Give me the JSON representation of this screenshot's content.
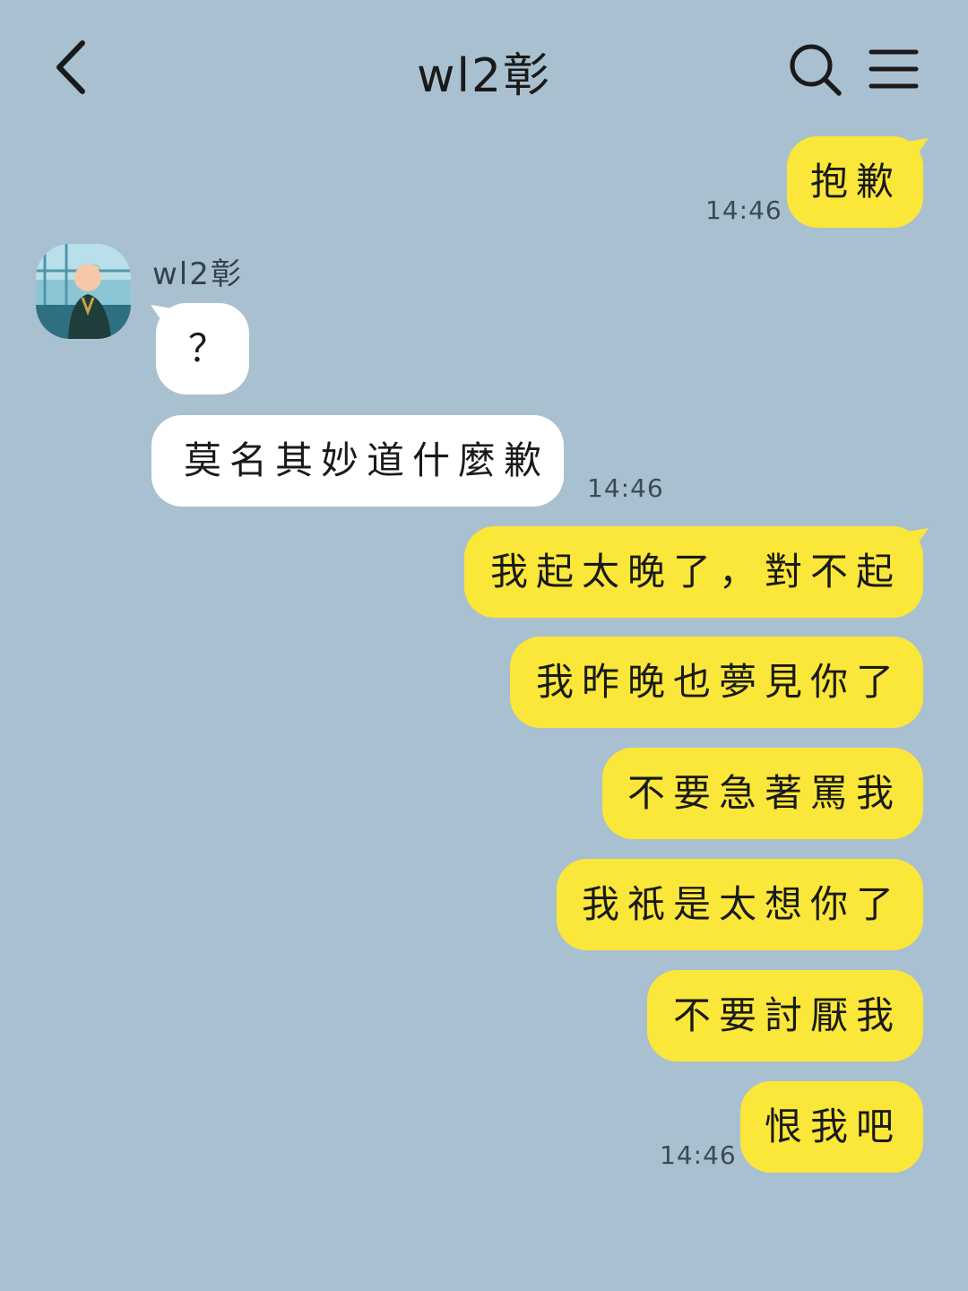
{
  "header": {
    "title": "wl2彰"
  },
  "contact": {
    "name": "wl2彰"
  },
  "messages": [
    {
      "from": "me",
      "text": "抱歉"
    },
    {
      "from": "them",
      "text": "？"
    },
    {
      "from": "them",
      "text": "莫名其妙道什麼歉"
    },
    {
      "from": "me",
      "text": "我起太晚了，對不起"
    },
    {
      "from": "me",
      "text": "我昨晚也夢見你了"
    },
    {
      "from": "me",
      "text": "不要急著罵我"
    },
    {
      "from": "me",
      "text": "我祇是太想你了"
    },
    {
      "from": "me",
      "text": "不要討厭我"
    },
    {
      "from": "me",
      "text": "恨我吧"
    }
  ],
  "timestamps": [
    "14:46",
    "14:46",
    "14:46"
  ],
  "colors": {
    "background": "#a9c0d0",
    "my_bubble": "#fbe73a",
    "their_bubble": "#ffffff"
  },
  "icons": [
    "back-arrow-icon",
    "search-icon",
    "menu-icon"
  ]
}
